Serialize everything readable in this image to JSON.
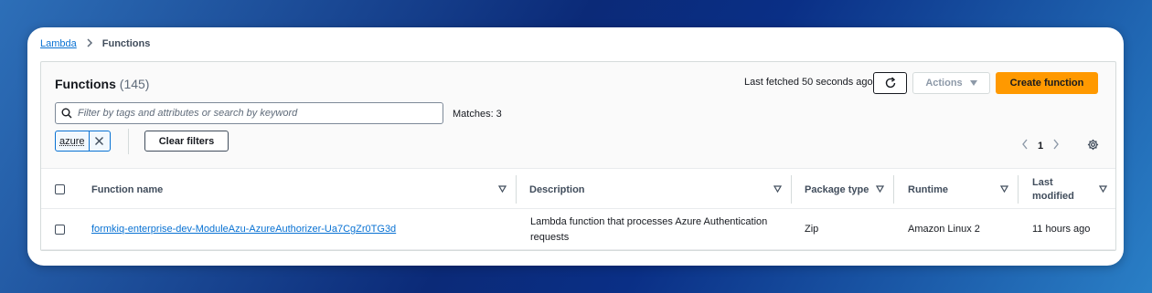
{
  "breadcrumb": {
    "root": "Lambda",
    "current": "Functions"
  },
  "header": {
    "title": "Functions",
    "count": "(145)",
    "last_fetched": "Last fetched 50 seconds ago",
    "actions_label": "Actions",
    "create_label": "Create function"
  },
  "filter": {
    "placeholder": "Filter by tags and attributes or search by keyword",
    "value": "",
    "matches": "Matches: 3",
    "tokens": [
      "azure"
    ],
    "clear_label": "Clear filters"
  },
  "pagination": {
    "current_page": "1"
  },
  "table": {
    "columns": [
      "Function name",
      "Description",
      "Package type",
      "Runtime",
      "Last modified"
    ],
    "rows": [
      {
        "function_name": "formkiq-enterprise-dev-ModuleAzu-AzureAuthorizer-Ua7CgZr0TG3d",
        "description": "Lambda function that processes Azure Authentication requests",
        "package_type": "Zip",
        "runtime": "Amazon Linux 2",
        "last_modified": "11 hours ago"
      }
    ]
  },
  "colors": {
    "accent": "#0972d3",
    "primary_button": "#ff9900",
    "text": "#16191f"
  },
  "icons": [
    "chevron-right-icon",
    "refresh-icon",
    "caret-down-icon",
    "search-icon",
    "close-icon",
    "chevron-left-icon",
    "gear-icon",
    "sort-icon"
  ]
}
